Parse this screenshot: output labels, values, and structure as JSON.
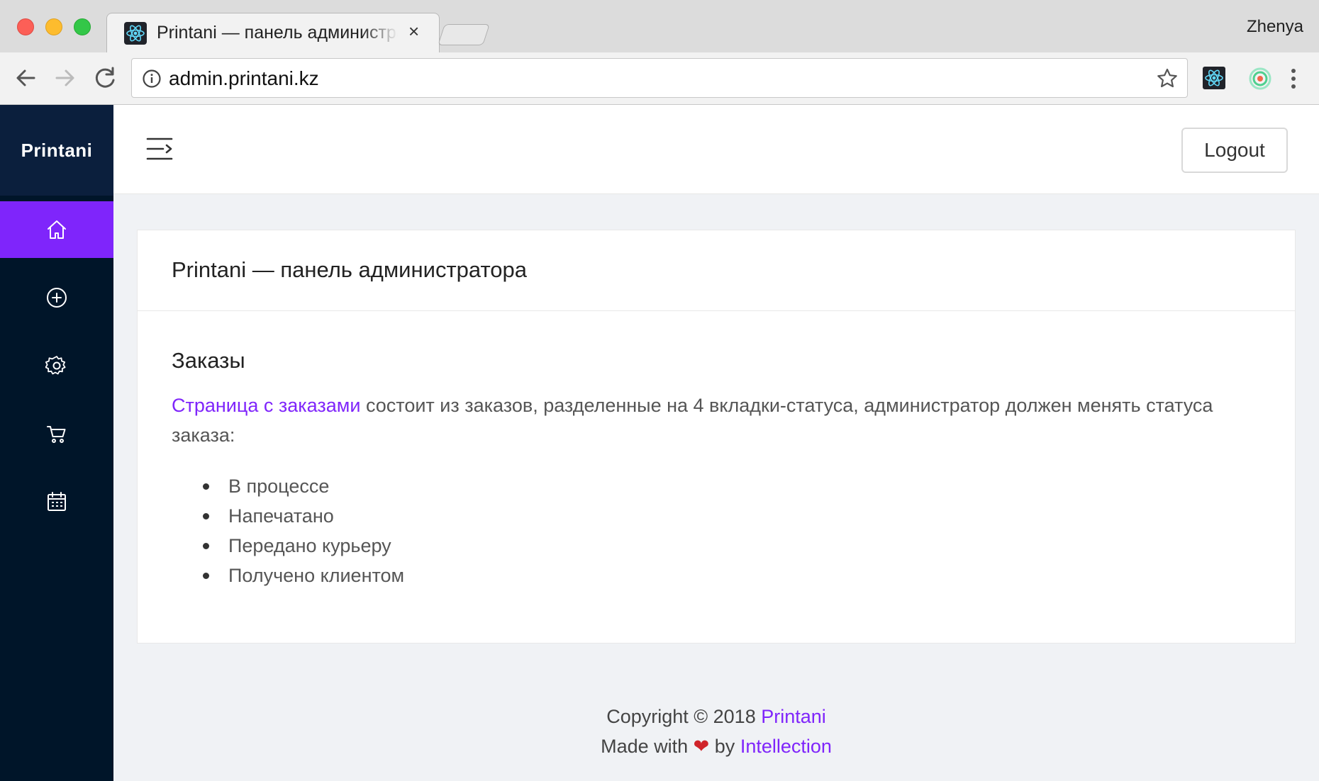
{
  "browser": {
    "tab_title": "Printani — панель администратора",
    "tab_close": "×",
    "url": "admin.printani.kz",
    "profile_name": "Zhenya"
  },
  "sidebar": {
    "logo": "Printani",
    "items": [
      {
        "icon": "home-icon",
        "active": true
      },
      {
        "icon": "plus-circle-icon",
        "active": false
      },
      {
        "icon": "settings-icon",
        "active": false
      },
      {
        "icon": "shopping-cart-icon",
        "active": false
      },
      {
        "icon": "calendar-icon",
        "active": false
      }
    ],
    "accent_color": "#7f25fb",
    "background_color": "#001529"
  },
  "header": {
    "logout_label": "Logout"
  },
  "card": {
    "title": "Printani — панель администратора",
    "section_title": "Заказы",
    "link_text": "Страница с заказами",
    "paragraph_rest": " состоит из заказов, разделенные на 4 вкладки-статуса, администратор должен менять статуса заказа:",
    "statuses": [
      "В процессе",
      "Напечатано",
      "Передано курьеру",
      "Получено клиентом"
    ]
  },
  "footer": {
    "copyright_prefix": "Copyright © 2018 ",
    "copyright_link": "Printani",
    "made_with": "Made with ",
    "heart": "❤",
    "by": " by ",
    "author_link": "Intellection"
  }
}
